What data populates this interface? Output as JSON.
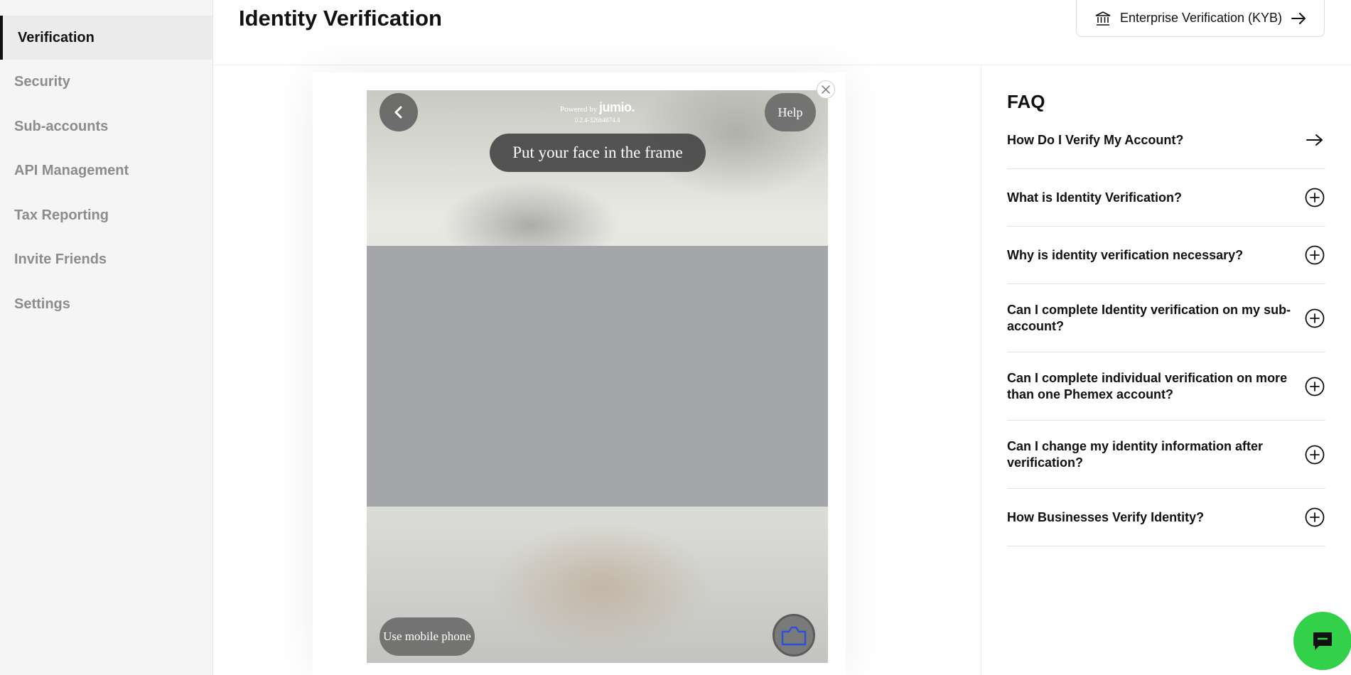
{
  "header": {
    "title": "Identity Verification",
    "kyb_button_label": "Enterprise Verification (KYB)"
  },
  "sidebar": {
    "items": [
      {
        "label": "Verification",
        "active": true
      },
      {
        "label": "Security"
      },
      {
        "label": "Sub-accounts"
      },
      {
        "label": "API Management"
      },
      {
        "label": "Tax Reporting"
      },
      {
        "label": "Invite Friends"
      },
      {
        "label": "Settings"
      }
    ]
  },
  "widget": {
    "powered_by": "Powered by",
    "brand": "jumio.",
    "version": "0.2.4-326b4874.4",
    "instruction": "Put your face in the frame",
    "help_label": "Help",
    "mobile_label": "Use mobile phone",
    "icons": [
      "chevron-left-icon",
      "close-icon",
      "camera-icon"
    ]
  },
  "faq": {
    "title": "FAQ",
    "items": [
      {
        "question": "How Do I Verify My Account?",
        "icon": "arrow-right-icon"
      },
      {
        "question": "What is Identity Verification?",
        "icon": "plus-circle-icon"
      },
      {
        "question": "Why is identity verification necessary?",
        "icon": "plus-circle-icon"
      },
      {
        "question": "Can I complete Identity verification on my sub-account?",
        "icon": "plus-circle-icon"
      },
      {
        "question": "Can I complete individual verification on more than one Phemex account?",
        "icon": "plus-circle-icon"
      },
      {
        "question": "Can I change my identity information after verification?",
        "icon": "plus-circle-icon"
      },
      {
        "question": "How Businesses Verify Identity?",
        "icon": "plus-circle-icon"
      }
    ]
  },
  "colors": {
    "chat_button": "#33d04a",
    "active_indicator": "#111111"
  }
}
